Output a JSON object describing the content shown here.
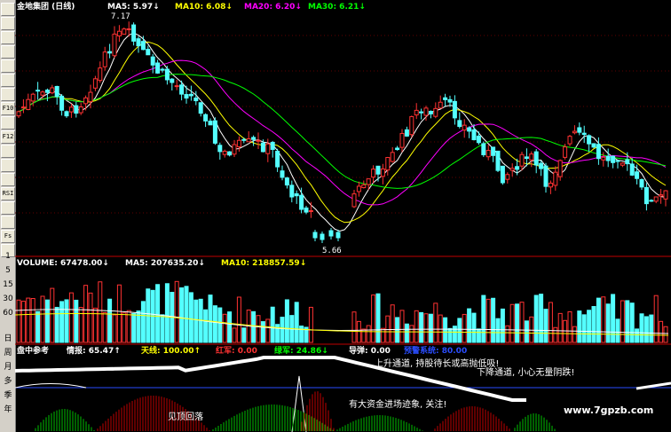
{
  "toolbar": {
    "icons": [
      "line-chart-icon",
      "candlestick-icon",
      "bar-chart-icon",
      "grid-icon",
      "price-table-icon",
      "document-icon",
      "chart-icon",
      "f10-icon",
      "file-icon",
      "f12-icon",
      "sync-icon",
      "pencil-icon",
      "calculator-icon",
      "rsi-icon",
      "swap-icon",
      "move-icon",
      "fs-icon",
      "list-icon"
    ],
    "icon_labels": [
      "",
      "",
      "",
      "",
      "",
      "",
      "",
      "F10",
      "",
      "F12",
      "",
      "",
      "",
      "RSI",
      "",
      "",
      "Fs",
      ""
    ],
    "numbers": [
      "1",
      "5",
      "15",
      "30",
      "60"
    ],
    "periods": [
      "日",
      "周",
      "月",
      "多",
      "季",
      "年"
    ]
  },
  "header": {
    "title": "金地集团 (日线)",
    "ma5": "MA5: 5.97↓",
    "ma10": "MA10: 6.08↓",
    "ma20": "MA20: 6.20↓",
    "ma30": "MA30: 6.21↓",
    "high_mark": "7.17",
    "low_mark": "5.66"
  },
  "volume": {
    "label": "VOLUME: 67478.00↓",
    "ma5": "MA5: 207635.20↓",
    "ma10": "MA10: 218857.59↓"
  },
  "indicator": {
    "name": "盘中参考",
    "info": "情报: 65.47↑",
    "sky": "天线: 100.00↑",
    "red": "红军: 0.00",
    "green": "绿军: 24.86↓",
    "guide": "导弹: 0.00",
    "blue": "预警系统: 80.00",
    "notes": [
      "上升通道, 持股待长或高抛低吸!",
      "下降通道, 小心无量阴跌!",
      "见顶回落",
      "有大资金进场迹象, 关注!"
    ]
  },
  "watermark": "www.7gpzb.com",
  "colors": {
    "up": "#ff3232",
    "down": "#54ffff",
    "ma5": "#ffffff",
    "ma10": "#ffff00",
    "ma20": "#ff00ff",
    "ma30": "#00ff00"
  },
  "chart_data": {
    "type": "candlestick",
    "price_high": 7.17,
    "price_low": 5.66
  }
}
